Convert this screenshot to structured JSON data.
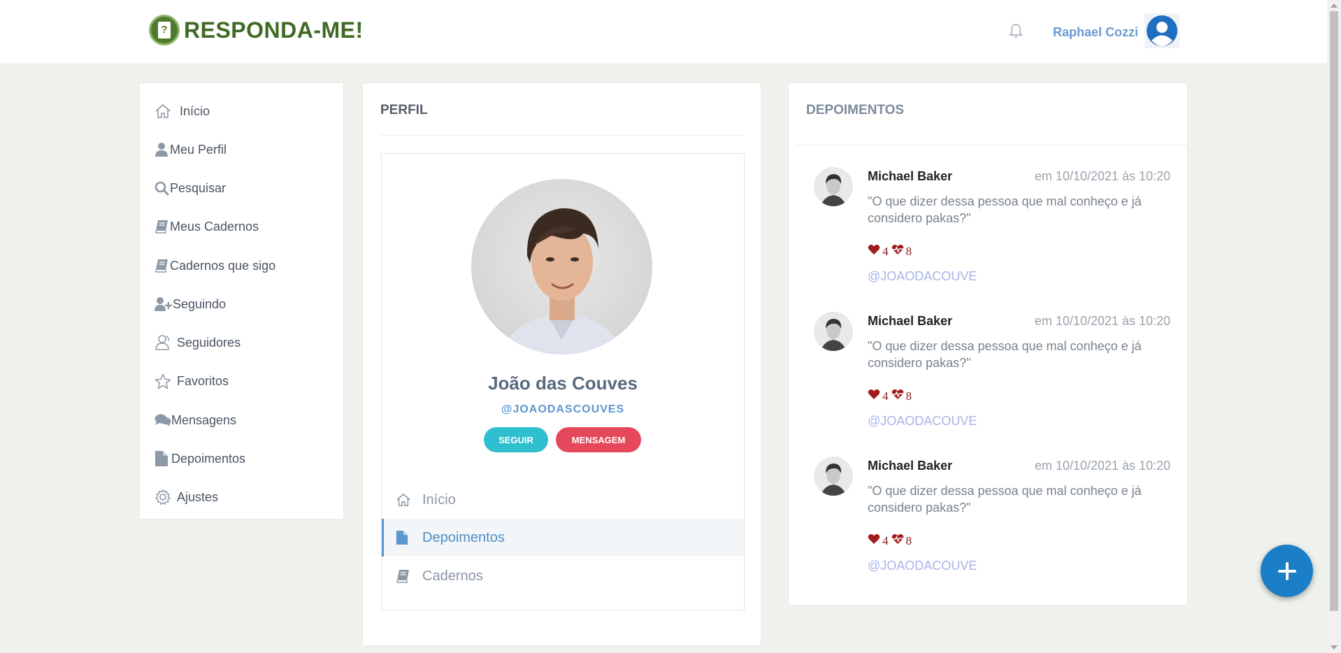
{
  "header": {
    "logo_text": "RESPONDA-ME!",
    "logo_mark": "?",
    "user_name": "Raphael Cozzi"
  },
  "sidebar": {
    "items": [
      {
        "label": "Início",
        "icon": "home-icon"
      },
      {
        "label": "Meu Perfil",
        "icon": "user-icon"
      },
      {
        "label": "Pesquisar",
        "icon": "search-icon"
      },
      {
        "label": "Meus Cadernos",
        "icon": "book-icon"
      },
      {
        "label": "Cadernos que sigo",
        "icon": "book-icon"
      },
      {
        "label": "Seguindo",
        "icon": "user-plus-icon"
      },
      {
        "label": "Seguidores",
        "icon": "users-icon"
      },
      {
        "label": "Favoritos",
        "icon": "star-icon"
      },
      {
        "label": "Mensagens",
        "icon": "comments-icon"
      },
      {
        "label": "Depoimentos",
        "icon": "file-icon"
      },
      {
        "label": "Ajustes",
        "icon": "gear-icon"
      }
    ]
  },
  "profile": {
    "panel_title": "PERFIL",
    "name": "João das Couves",
    "handle": "@JOAODASCOUVES",
    "follow_label": "SEGUIR",
    "message_label": "MENSAGEM",
    "tabs": [
      {
        "label": "Início",
        "active": false
      },
      {
        "label": "Depoimentos",
        "active": true
      },
      {
        "label": "Cadernos",
        "active": false
      }
    ]
  },
  "testimonials": {
    "title": "DEPOIMENTOS",
    "items": [
      {
        "author": "Michael Baker",
        "date": "em 10/10/2021 às 10:20",
        "text": "\"O que dizer dessa pessoa que mal conheço e já considero pakas?\"",
        "likes": "4",
        "hearts": "8",
        "handle": "@JOAODACOUVE"
      },
      {
        "author": "Michael Baker",
        "date": "em 10/10/2021 às 10:20",
        "text": "\"O que dizer dessa pessoa que mal conheço e já considero pakas?\"",
        "likes": "4",
        "hearts": "8",
        "handle": "@JOAODACOUVE"
      },
      {
        "author": "Michael Baker",
        "date": "em 10/10/2021 às 10:20",
        "text": "\"O que dizer dessa pessoa que mal conheço e já considero pakas?\"",
        "likes": "4",
        "hearts": "8",
        "handle": "@JOAODACOUVE"
      }
    ]
  },
  "fab": {
    "icon": "plus-icon"
  },
  "colors": {
    "accent": "#5b97cf",
    "follow": "#2fbfcf",
    "message": "#e5485a",
    "fab": "#1b7fc8",
    "reaction": "#8b1c1c"
  }
}
